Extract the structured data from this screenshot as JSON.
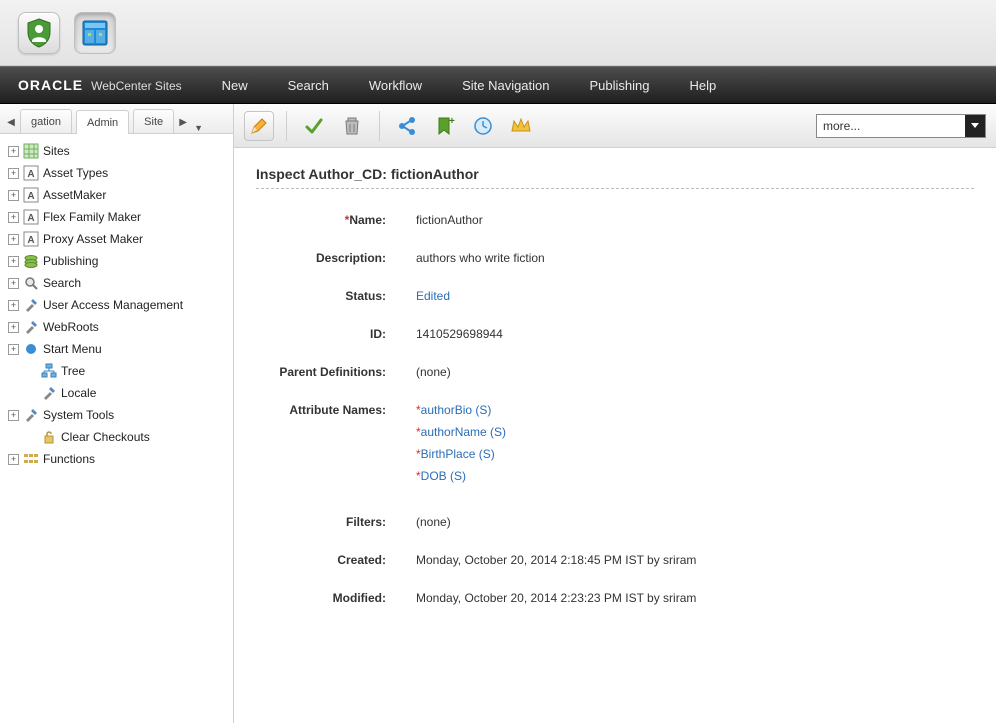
{
  "brand": {
    "oracle": "ORACLE",
    "product": "WebCenter Sites"
  },
  "menu": {
    "new": "New",
    "search": "Search",
    "workflow": "Workflow",
    "sitenav": "Site Navigation",
    "publishing": "Publishing",
    "help": "Help"
  },
  "toolbar": {
    "more": "more..."
  },
  "tabs": {
    "left": "gation",
    "active": "Admin",
    "right": "Site"
  },
  "tree": {
    "sites": "Sites",
    "assetTypes": "Asset Types",
    "assetMaker": "AssetMaker",
    "flexFamily": "Flex Family Maker",
    "proxyAsset": "Proxy Asset Maker",
    "publishing": "Publishing",
    "search": "Search",
    "userAccess": "User Access Management",
    "webroots": "WebRoots",
    "startMenu": "Start Menu",
    "treeNode": "Tree",
    "locale": "Locale",
    "systemTools": "System Tools",
    "clearCheckouts": "Clear Checkouts",
    "functions": "Functions"
  },
  "page": {
    "title": "Inspect Author_CD: fictionAuthor",
    "labels": {
      "name": "Name:",
      "description": "Description:",
      "status": "Status:",
      "id": "ID:",
      "parentDefs": "Parent Definitions:",
      "attrNames": "Attribute Names:",
      "filters": "Filters:",
      "created": "Created:",
      "modified": "Modified:"
    },
    "values": {
      "name": "fictionAuthor",
      "description": "authors who write fiction",
      "status": "Edited",
      "id": "1410529698944",
      "parentDefs": "(none)",
      "filters": "(none)",
      "created": "Monday, October 20, 2014 2:18:45 PM IST by sriram",
      "modified": "Monday, October 20, 2014 2:23:23 PM IST by sriram"
    },
    "attributes": [
      {
        "name": "authorBio (S)"
      },
      {
        "name": "authorName (S)"
      },
      {
        "name": "BirthPlace (S)"
      },
      {
        "name": "DOB (S)"
      }
    ]
  }
}
